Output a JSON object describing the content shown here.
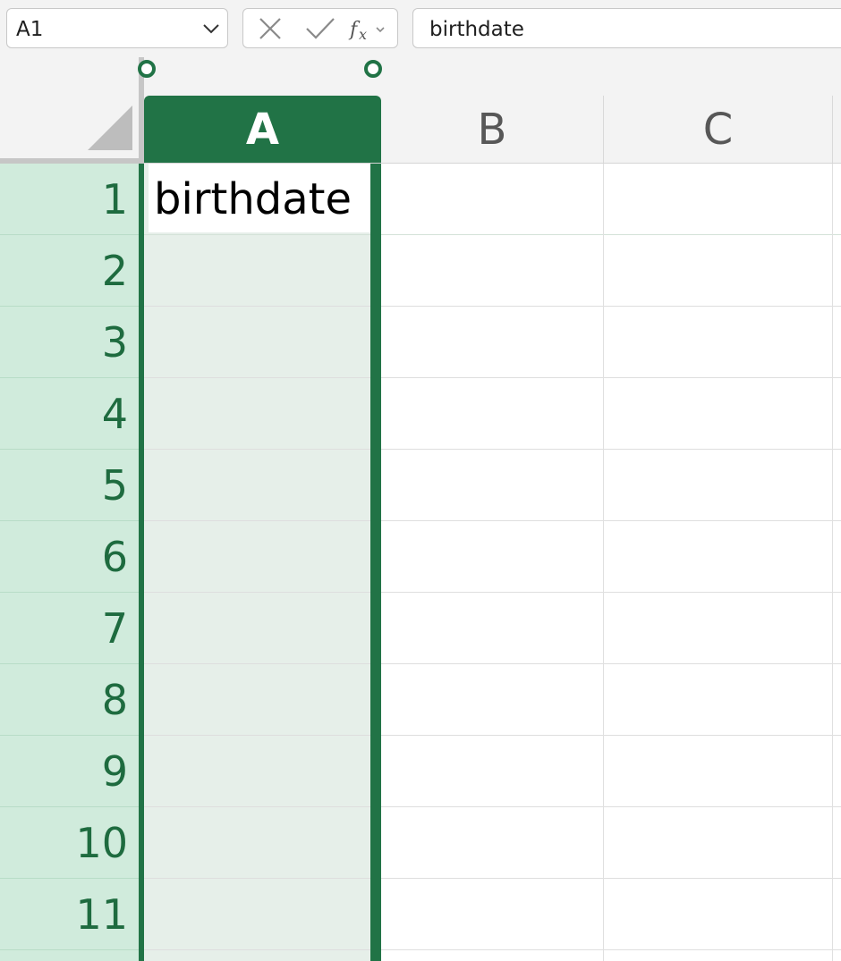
{
  "formula_bar": {
    "name_box": "A1",
    "formula": "birthdate",
    "buttons": [
      "cancel",
      "enter",
      "insert-function"
    ]
  },
  "columns": [
    {
      "label": "A",
      "selected": true
    },
    {
      "label": "B",
      "selected": false
    },
    {
      "label": "C",
      "selected": false
    }
  ],
  "rows": [
    "1",
    "2",
    "3",
    "4",
    "5",
    "6",
    "7",
    "8",
    "9",
    "10",
    "11"
  ],
  "cells": {
    "A1": "birthdate"
  },
  "colors": {
    "accent": "#217346",
    "row_header_bg": "#d0ebdc",
    "selected_column_bg": "#e6efe9"
  }
}
